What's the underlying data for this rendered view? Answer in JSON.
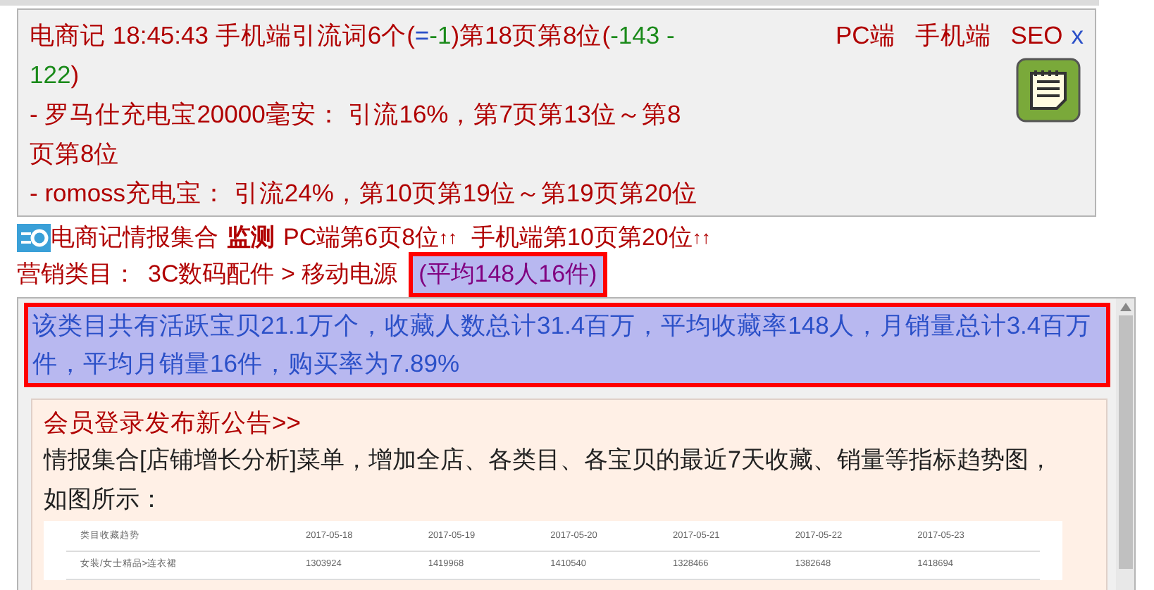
{
  "summary_box": {
    "headline": [
      {
        "text": "电商记 18:45:43 手机端引流词6个(",
        "color": "#b00000"
      },
      {
        "text": "=",
        "color": "#2b50c8"
      },
      {
        "text": "-1",
        "color": "#1a8a1a"
      },
      {
        "text": ")第18页第8位(",
        "color": "#b00000"
      },
      {
        "text": "-143",
        "color": "#1a8a1a"
      },
      {
        "text": " - ",
        "color": "#1a8a1a"
      },
      {
        "text": "122",
        "color": "#1a8a1a"
      },
      {
        "text": ")",
        "color": "#b00000"
      }
    ],
    "lines": [
      " - 罗马仕充电宝20000毫安： 引流16%，第7页第13位～第8页第8位",
      " - romoss充电宝： 引流24%，第10页第19位～第19页第20位"
    ],
    "links": [
      "PC端",
      "手机端",
      "SEO"
    ],
    "close": "x"
  },
  "monitor": {
    "title": "电商记情报集合",
    "action": "监测",
    "pc": "PC端第6页8位",
    "pc_arrows": "↑↑",
    "mobile": "手机端第10页第20位",
    "mobile_arrows": "↑↑"
  },
  "category": {
    "label": "营销类目：",
    "path": "3C数码配件 > 移动电源",
    "average": "(平均148人16件)"
  },
  "stats": "该类目共有活跃宝贝21.1万个，收藏人数总计31.4百万，平均收藏率148人，月销量总计3.4百万件，平均月销量16件，购买率为7.89%",
  "notice": {
    "title": "会员登录发布新公告>>",
    "body": "情报集合[店铺增长分析]菜单，增加全店、各类目、各宝贝的最近7天收藏、销量等指标趋势图，如图所示：",
    "table": {
      "columns": [
        "类目收藏趋势",
        "2017-05-18",
        "2017-05-19",
        "2017-05-20",
        "2017-05-21",
        "2017-05-22",
        "2017-05-23"
      ],
      "rows": [
        [
          "女装/女士精品>连衣裙",
          "1303924",
          "1419968",
          "1410540",
          "1328466",
          "1382648",
          "1418694"
        ]
      ]
    }
  }
}
